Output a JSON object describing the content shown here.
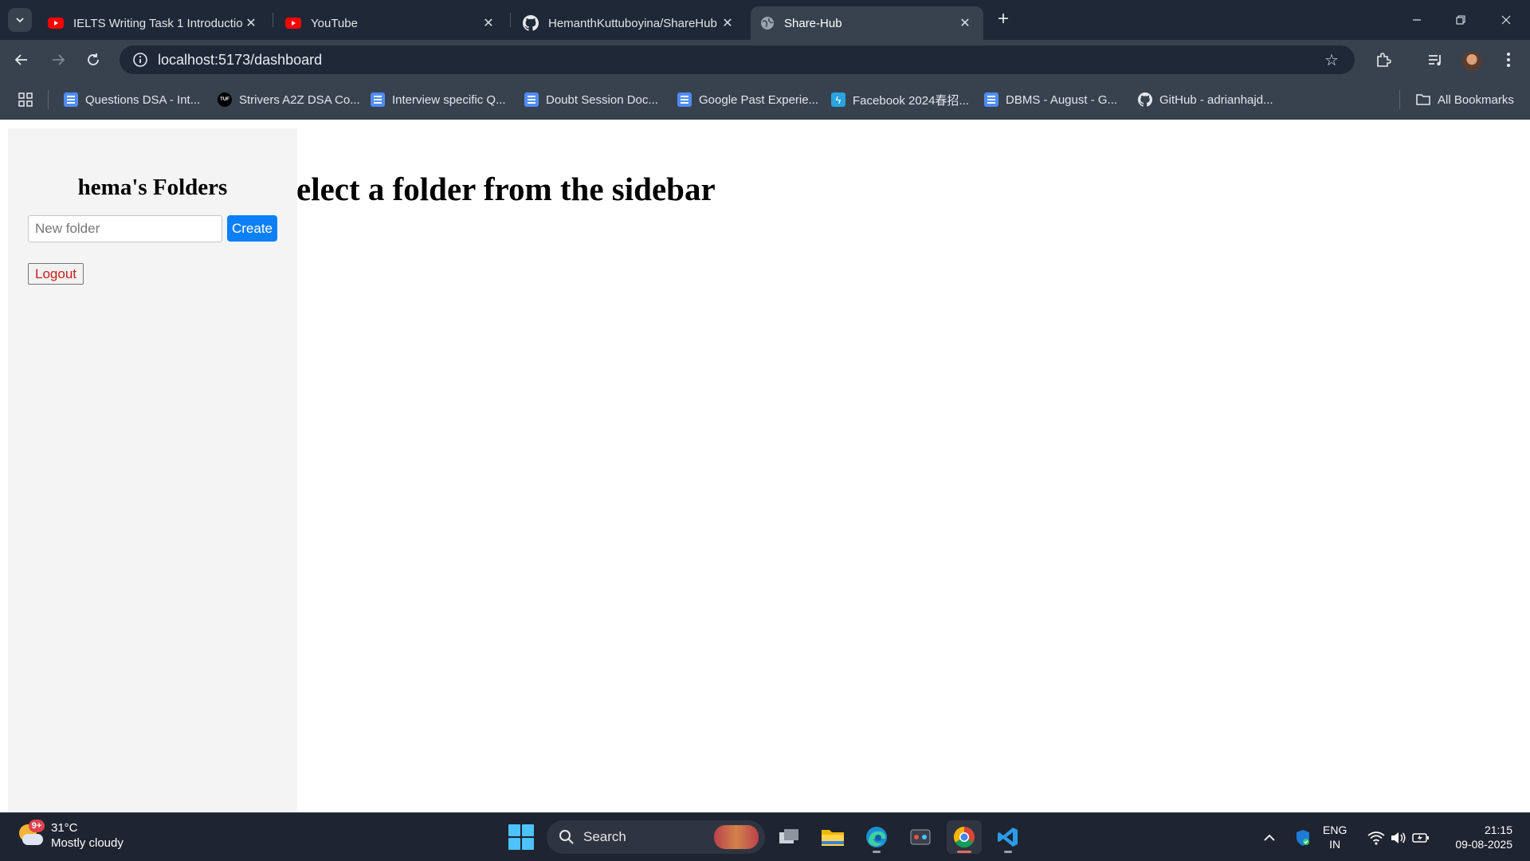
{
  "browser": {
    "tabs": [
      {
        "title": "IELTS Writing Task 1 Introductio",
        "icon": "youtube-icon",
        "active": false
      },
      {
        "title": "YouTube",
        "icon": "youtube-icon",
        "active": false
      },
      {
        "title": "HemanthKuttuboyina/ShareHub",
        "icon": "github-icon",
        "active": false
      },
      {
        "title": "Share-Hub",
        "icon": "globe-icon",
        "active": true
      }
    ],
    "url": "localhost:5173/dashboard",
    "bookmarks": [
      {
        "label": "Questions DSA - Int...",
        "icon": "docs-icon"
      },
      {
        "label": "Strivers A2Z DSA Co...",
        "icon": "tuf-icon"
      },
      {
        "label": "Interview specific Q...",
        "icon": "docs-icon"
      },
      {
        "label": "Doubt Session Doc...",
        "icon": "docs-icon"
      },
      {
        "label": "Google Past Experie...",
        "icon": "docs-icon"
      },
      {
        "label": "Facebook 2024春招...",
        "icon": "bolt-icon"
      },
      {
        "label": "DBMS - August - G...",
        "icon": "docs-icon"
      },
      {
        "label": "GitHub - adrianhajd...",
        "icon": "github-icon"
      }
    ],
    "all_bookmarks_label": "All Bookmarks",
    "colors": {
      "frame": "#1e2836",
      "toolbar": "#38424f"
    }
  },
  "sidebar": {
    "title": "hema's Folders",
    "new_folder_placeholder": "New folder",
    "new_folder_value": "",
    "create_label": "Create",
    "logout_label": "Logout"
  },
  "main": {
    "heading": "elect a folder from the sidebar"
  },
  "app_colors": {
    "create_button": "#0d7ff7",
    "logout_text": "#d11a1a",
    "sidebar_bg": "#f4f4f4"
  },
  "taskbar": {
    "weather": {
      "temp": "31°C",
      "desc": "Mostly cloudy",
      "badge": "9+"
    },
    "search_label": "Search",
    "apps": [
      "task-view-icon",
      "edge-icon",
      "file-explorer-icon",
      "snipping-icon",
      "chrome-icon",
      "vscode-icon"
    ],
    "language": {
      "line1": "ENG",
      "line2": "IN"
    },
    "clock": {
      "time": "21:15",
      "date": "09-08-2025"
    }
  }
}
